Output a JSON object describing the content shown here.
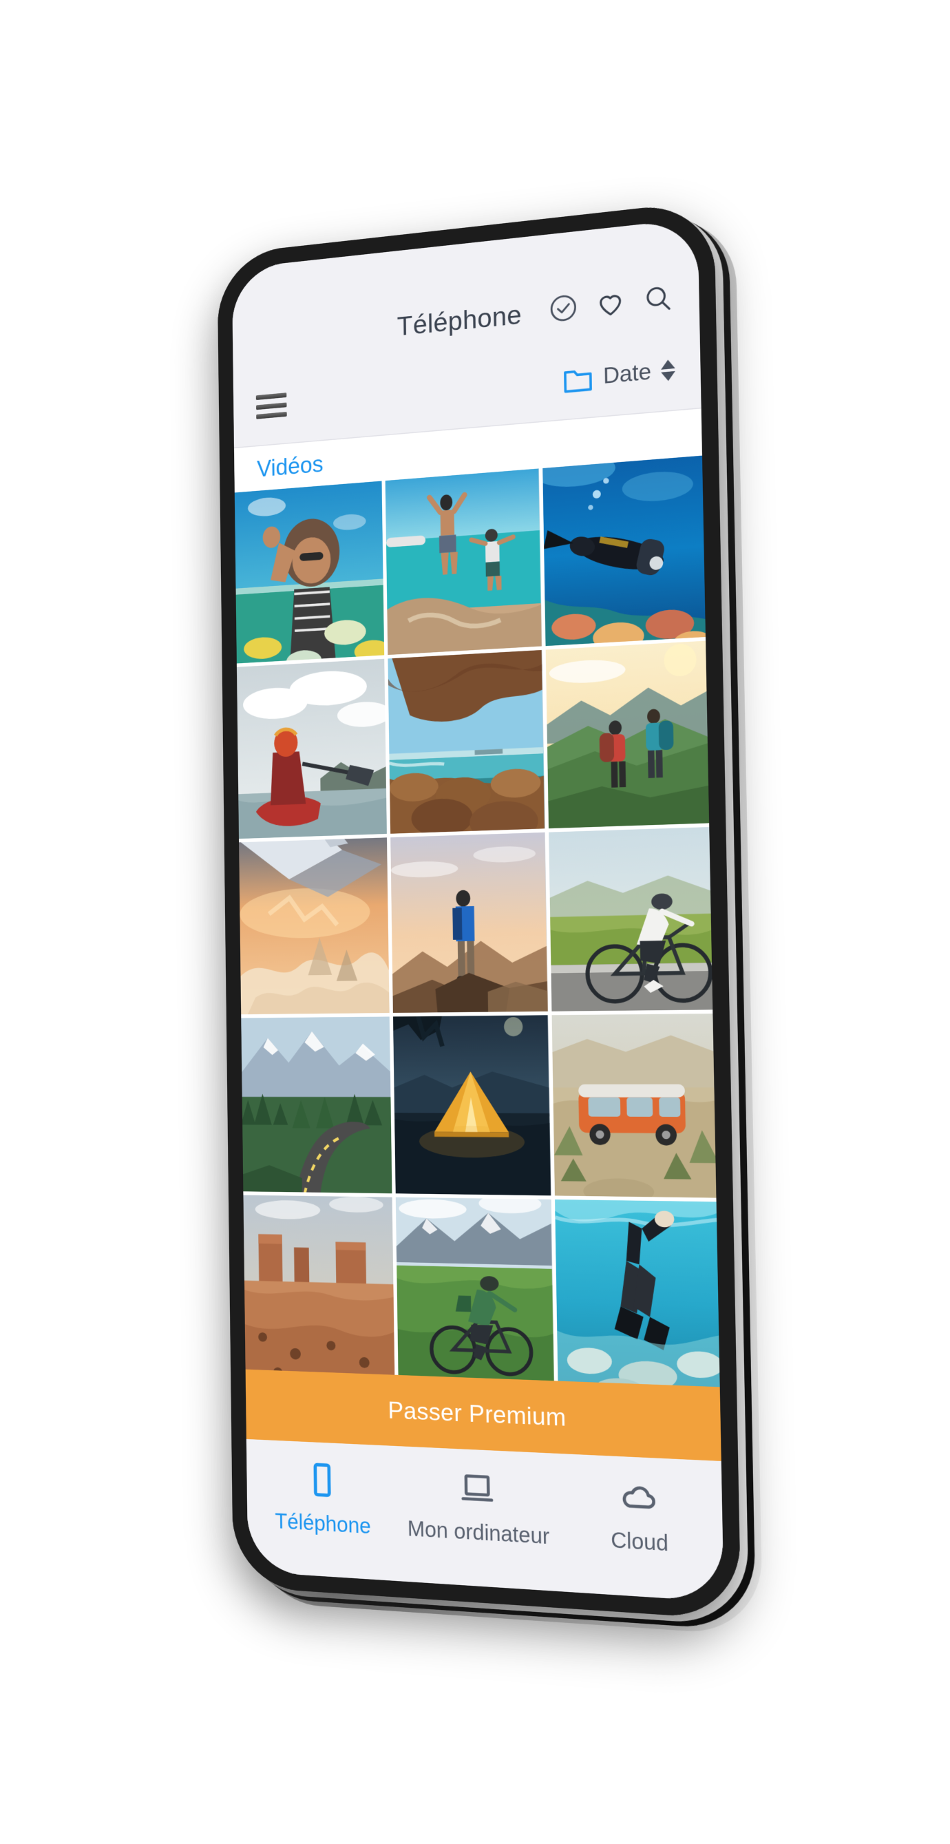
{
  "app": {
    "platform": "mobile-phone-mockup",
    "accent_color": "#1e96f0",
    "premium_color": "#f2a13c",
    "screen_bg": "#f1f1f5"
  },
  "header": {
    "title": "Téléphone",
    "actions": [
      {
        "name": "select-all-icon",
        "icon": "check-circle-icon"
      },
      {
        "name": "favorites-icon",
        "icon": "heart-icon"
      },
      {
        "name": "search-icon",
        "icon": "search-icon"
      }
    ]
  },
  "subheader": {
    "menu_icon": "hamburger-menu-icon",
    "folder_icon": "folder-icon",
    "sort_label": "Date",
    "sort_direction_icon": "sort-arrows-icon"
  },
  "section": {
    "label": "Vidéos"
  },
  "grid": {
    "columns": 3,
    "rows": 5,
    "items": [
      {
        "name": "photo-snorkeling-woman",
        "alt": "Woman snorkeling with fish underwater",
        "theme": "snorkel"
      },
      {
        "name": "photo-cliff-jump",
        "alt": "Two people jumping into turquoise sea",
        "theme": "jump"
      },
      {
        "name": "photo-scuba-diver",
        "alt": "Scuba diver over coral reef",
        "theme": "scuba"
      },
      {
        "name": "photo-kayaker",
        "alt": "Kayaker paddling on a lake",
        "theme": "kayak"
      },
      {
        "name": "photo-sea-arch",
        "alt": "Rock arch over the sea",
        "theme": "arch"
      },
      {
        "name": "photo-hikers-ridge",
        "alt": "Two hikers with backpacks on green ridge",
        "theme": "ridge"
      },
      {
        "name": "photo-plane-wing-sunset",
        "alt": "Airplane wing above clouds at sunset",
        "theme": "plane"
      },
      {
        "name": "photo-summit-hiker",
        "alt": "Hiker standing on mountain summit",
        "theme": "summit"
      },
      {
        "name": "photo-road-cyclist",
        "alt": "Cyclist riding on a country road",
        "theme": "cyclist"
      },
      {
        "name": "photo-mountain-road",
        "alt": "Winding road through pine forest and mountains",
        "theme": "road"
      },
      {
        "name": "photo-night-tent",
        "alt": "Glowing yellow tent by a lake at dusk",
        "theme": "tent"
      },
      {
        "name": "photo-camper-van",
        "alt": "Orange camper van in the desert",
        "theme": "van"
      },
      {
        "name": "photo-desert-buttes",
        "alt": "Red desert buttes landscape",
        "theme": "desert"
      },
      {
        "name": "photo-mountain-biker",
        "alt": "Mountain biker on green alpine meadow",
        "theme": "mtb"
      },
      {
        "name": "photo-freediver",
        "alt": "Freediver swimming underwater with fins",
        "theme": "freedive"
      }
    ]
  },
  "premium": {
    "label": "Passer Premium"
  },
  "bottom_nav": {
    "items": [
      {
        "name": "nav-telephone",
        "label": "Téléphone",
        "icon": "phone-icon",
        "active": true
      },
      {
        "name": "nav-computer",
        "label": "Mon ordinateur",
        "icon": "computer-icon",
        "active": false
      },
      {
        "name": "nav-cloud",
        "label": "Cloud",
        "icon": "cloud-icon",
        "active": false
      }
    ]
  }
}
